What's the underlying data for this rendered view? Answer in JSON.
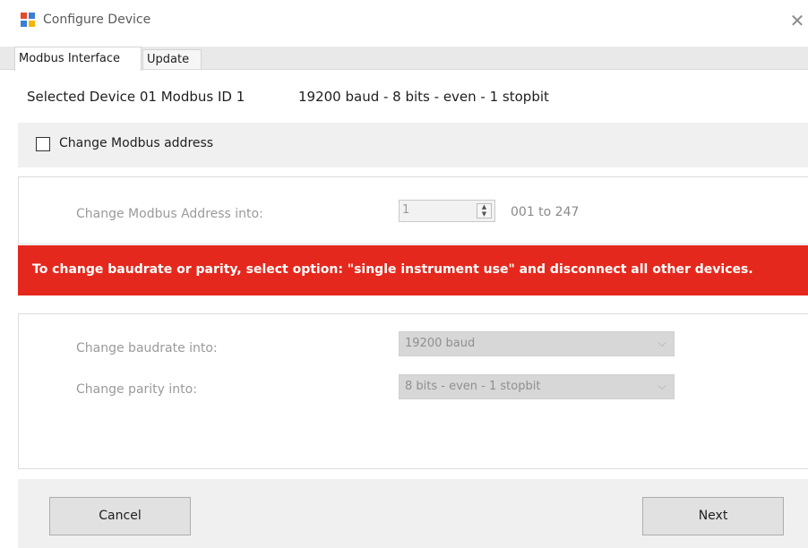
{
  "window": {
    "title": "Configure Device",
    "app_icon": "configure-device-icon",
    "close_icon": "close-icon",
    "close_glyph": "✕"
  },
  "tabs": [
    {
      "label": "Modbus Interface",
      "active": true
    },
    {
      "label": "Update",
      "active": false
    }
  ],
  "device": {
    "selected": "Selected Device 01 Modbus ID 1",
    "params": "19200 baud - 8 bits - even - 1 stopbit"
  },
  "address": {
    "checkbox_label": "Change Modbus address",
    "checked": false,
    "field_label": "Change Modbus Address into:",
    "value": "1",
    "range": "001 to 247"
  },
  "warning": {
    "text": "To change baudrate or parity, select option: \"single instrument use\" and disconnect all other devices.",
    "color": "#e5281d"
  },
  "baud": {
    "label": "Change baudrate into:",
    "value": "19200 baud"
  },
  "parity": {
    "label": "Change parity into:",
    "value": "8 bits - even - 1 stopbit"
  },
  "buttons": {
    "cancel": "Cancel",
    "next": "Next"
  }
}
